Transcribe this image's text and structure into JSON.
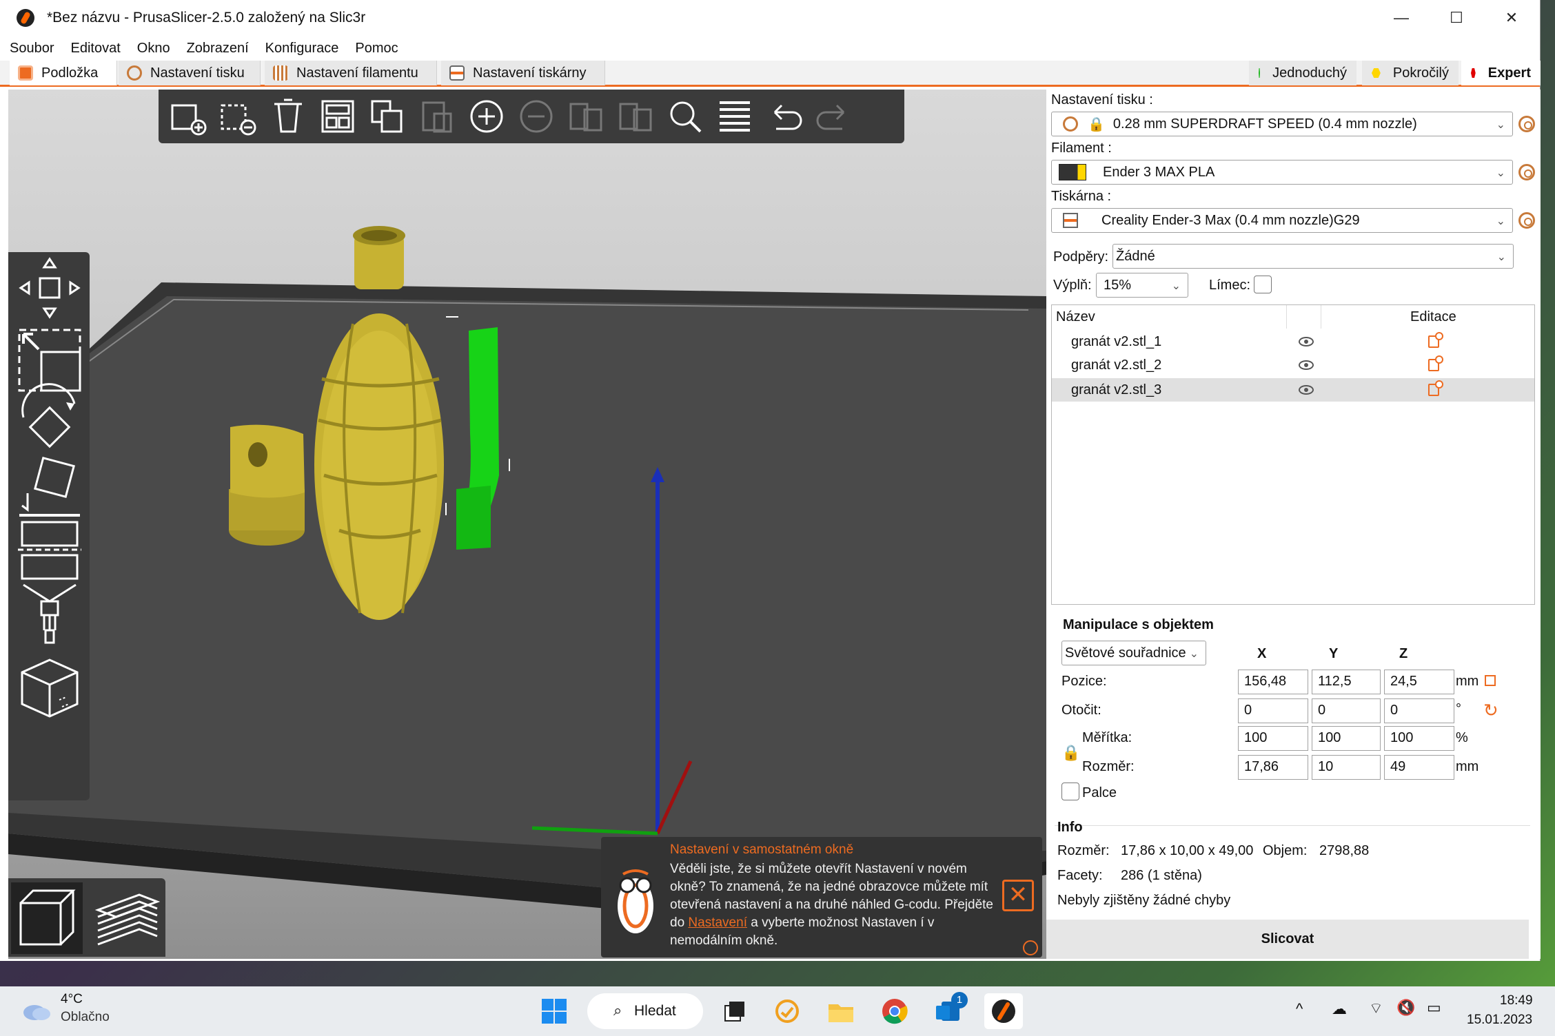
{
  "window": {
    "title": "*Bez názvu - PrusaSlicer-2.5.0 založený na Slic3r",
    "minimize": "—",
    "maximize": "☐",
    "close": "✕"
  },
  "menu": [
    "Soubor",
    "Editovat",
    "Okno",
    "Zobrazení",
    "Konfigurace",
    "Pomoc"
  ],
  "tabs": {
    "plater": "Podložka",
    "print": "Nastavení tisku",
    "filament": "Nastavení filamentu",
    "printer": "Nastavení tiskárny"
  },
  "modes": {
    "simple": "Jednoduchý",
    "advanced": "Pokročilý",
    "expert": "Expert",
    "colors": {
      "simple": "#00b000",
      "advanced": "#ffd600",
      "expert": "#e00000"
    }
  },
  "accent": "#ed6b21",
  "panel": {
    "print_settings_label": "Nastavení tisku :",
    "print_settings_value": "0.28 mm SUPERDRAFT SPEED (0.4 mm nozzle)",
    "filament_label": "Filament :",
    "filament_value": "Ender 3 MAX PLA",
    "printer_label": "Tiskárna :",
    "printer_value": "Creality Ender-3 Max (0.4 mm nozzle)G29",
    "supports_label": "Podpěry:",
    "supports_value": "Žádné",
    "infill_label": "Výplň:",
    "infill_value": "15%",
    "brim_label": "Límec:"
  },
  "objects": {
    "col_name": "Název",
    "col_edit": "Editace",
    "items": [
      {
        "name": "granát v2.stl_1"
      },
      {
        "name": "granát v2.stl_2"
      },
      {
        "name": "granát v2.stl_3"
      }
    ]
  },
  "manip": {
    "title": "Manipulace s objektem",
    "coords": "Světové souřadnice",
    "x": "X",
    "y": "Y",
    "z": "Z",
    "position_label": "Pozice:",
    "position": [
      "156,48",
      "112,5",
      "24,5"
    ],
    "position_unit": "mm",
    "rotate_label": "Otočit:",
    "rotate": [
      "0",
      "0",
      "0"
    ],
    "rotate_unit": "°",
    "scale_label": "Měřítka:",
    "scale": [
      "100",
      "100",
      "100"
    ],
    "scale_unit": "%",
    "size_label": "Rozměr:",
    "size": [
      "17,86",
      "10",
      "49"
    ],
    "size_unit": "mm",
    "inches_label": "Palce"
  },
  "info": {
    "title": "Info",
    "size_label": "Rozměr:",
    "size_value": "17,86 x 10,00 x 49,00",
    "volume_label": "Objem:",
    "volume_value": "2798,88",
    "facets_label": "Facety:",
    "facets_value": "286 (1 stěna)",
    "errors": "Nebyly zjištěny žádné chyby"
  },
  "slice_button": "Slicovat",
  "notification": {
    "title": "Nastavení v samostatném okně",
    "text_before": "Věděli jste, že si můžete otevřít Nastavení v novém okně? To znamená, že na jedné obrazovce můžete mít otevřená nastavení a na druhé náhled G-codu. Přejděte do",
    "link": "Nastavení",
    "text_after": "a vyberte možnost Nastaven í v nemodálním okně."
  },
  "taskbar": {
    "weather_temp": "4°C",
    "weather_desc": "Oblačno",
    "search": "Hledat",
    "badge": "1",
    "time": "18:49",
    "date": "15.01.2023"
  }
}
